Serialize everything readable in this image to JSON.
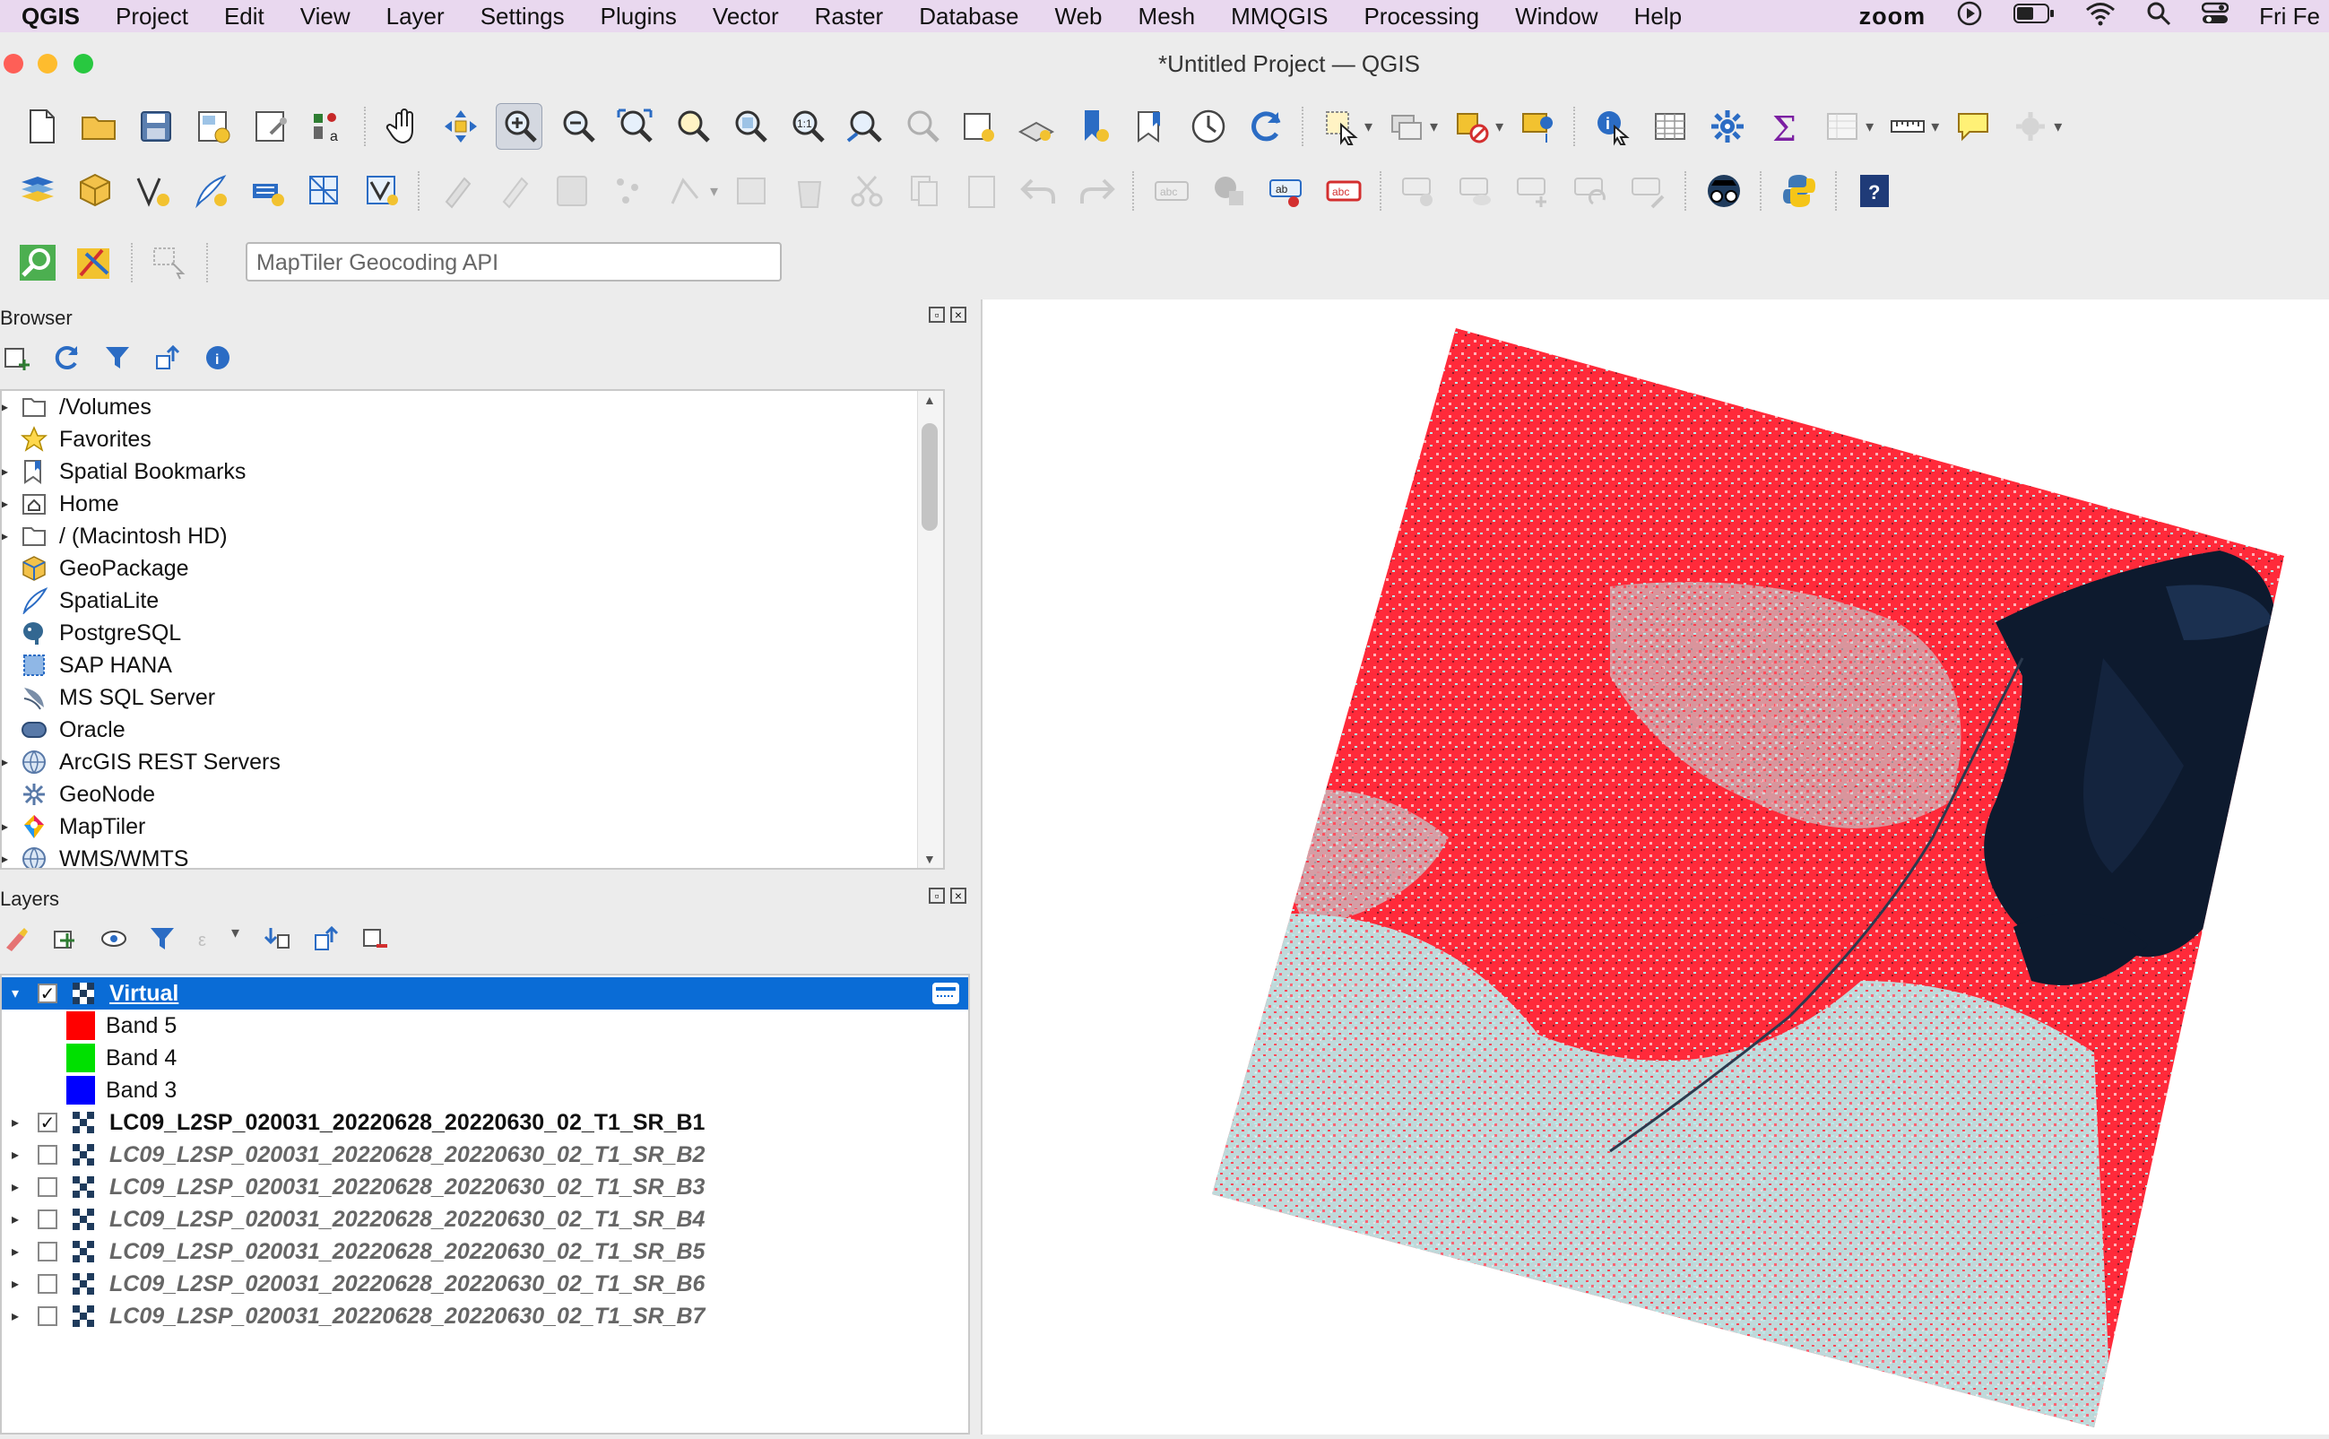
{
  "menubar": {
    "app_name": "QGIS",
    "items": [
      "Project",
      "Edit",
      "View",
      "Layer",
      "Settings",
      "Plugins",
      "Vector",
      "Raster",
      "Database",
      "Web",
      "Mesh",
      "MMQGIS",
      "Processing",
      "Window",
      "Help"
    ],
    "zoom_label": "zoom",
    "clock": "Fri Fe"
  },
  "window": {
    "title": "*Untitled Project — QGIS"
  },
  "locator": {
    "placeholder": "MapTiler Geocoding API"
  },
  "browser": {
    "title": "Browser",
    "items": [
      {
        "label": "/Volumes",
        "icon": "folder-icon",
        "expandable": true
      },
      {
        "label": "Favorites",
        "icon": "star-icon",
        "expandable": false
      },
      {
        "label": "Spatial Bookmarks",
        "icon": "bookmark-icon",
        "expandable": true
      },
      {
        "label": "Home",
        "icon": "home-folder-icon",
        "expandable": true
      },
      {
        "label": "/ (Macintosh HD)",
        "icon": "folder-icon",
        "expandable": true
      },
      {
        "label": "GeoPackage",
        "icon": "geopackage-icon",
        "expandable": false
      },
      {
        "label": "SpatiaLite",
        "icon": "feather-icon",
        "expandable": false
      },
      {
        "label": "PostgreSQL",
        "icon": "elephant-icon",
        "expandable": false
      },
      {
        "label": "SAP HANA",
        "icon": "database-icon",
        "expandable": false
      },
      {
        "label": "MS SQL Server",
        "icon": "mssql-icon",
        "expandable": false
      },
      {
        "label": "Oracle",
        "icon": "oracle-icon",
        "expandable": false
      },
      {
        "label": "ArcGIS REST Servers",
        "icon": "globe-icon",
        "expandable": true
      },
      {
        "label": "GeoNode",
        "icon": "geonode-icon",
        "expandable": false
      },
      {
        "label": "MapTiler",
        "icon": "maptiler-icon",
        "expandable": true
      },
      {
        "label": "WMS/WMTS",
        "icon": "globe-icon",
        "expandable": true
      }
    ]
  },
  "layers": {
    "title": "Layers",
    "rows": [
      {
        "label": "Virtual",
        "type": "group",
        "checked": true,
        "selected": true
      },
      {
        "label": "Band 5",
        "type": "band",
        "color": "#ff0000"
      },
      {
        "label": "Band 4",
        "type": "band",
        "color": "#00e000"
      },
      {
        "label": "Band 3",
        "type": "band",
        "color": "#0000ff"
      },
      {
        "label": "LC09_L2SP_020031_20220628_20220630_02_T1_SR_B1",
        "type": "layer",
        "checked": true
      },
      {
        "label": "LC09_L2SP_020031_20220628_20220630_02_T1_SR_B2",
        "type": "layer",
        "checked": false
      },
      {
        "label": "LC09_L2SP_020031_20220628_20220630_02_T1_SR_B3",
        "type": "layer",
        "checked": false
      },
      {
        "label": "LC09_L2SP_020031_20220628_20220630_02_T1_SR_B4",
        "type": "layer",
        "checked": false
      },
      {
        "label": "LC09_L2SP_020031_20220628_20220630_02_T1_SR_B5",
        "type": "layer",
        "checked": false
      },
      {
        "label": "LC09_L2SP_020031_20220628_20220630_02_T1_SR_B6",
        "type": "layer",
        "checked": false
      },
      {
        "label": "LC09_L2SP_020031_20220628_20220630_02_T1_SR_B7",
        "type": "layer",
        "checked": false
      }
    ]
  },
  "colors": {
    "menubar_bg": "#e9d8ef",
    "selection": "#0a6cd6",
    "raster_red": "#ff2a3a",
    "raster_cyan": "#a8ecec",
    "lake_dark": "#0d1a2e"
  }
}
